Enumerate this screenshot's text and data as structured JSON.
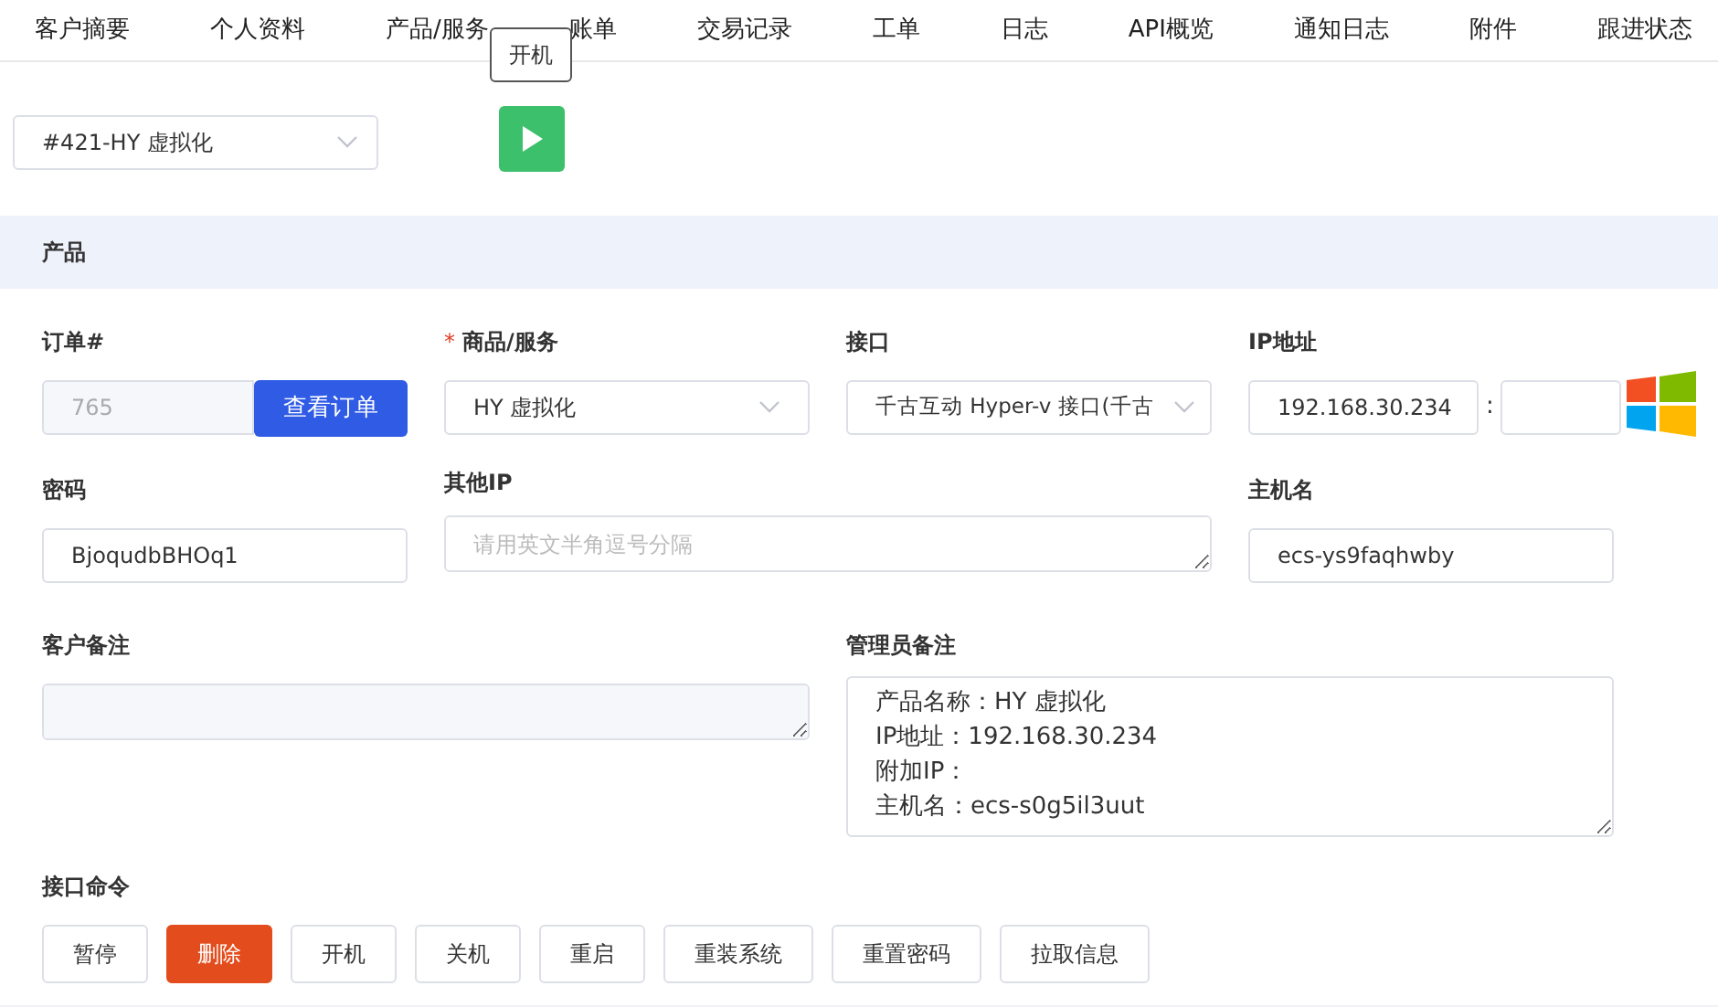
{
  "tabs": [
    {
      "label": "客户摘要",
      "selected": false
    },
    {
      "label": "个人资料",
      "selected": false
    },
    {
      "label": "产品/服务",
      "selected": false
    },
    {
      "label": "账单",
      "selected": false
    },
    {
      "label": "交易记录",
      "selected": false
    },
    {
      "label": "工单",
      "selected": false
    },
    {
      "label": "日志",
      "selected": false
    },
    {
      "label": "API概览",
      "selected": false
    },
    {
      "label": "通知日志",
      "selected": false
    },
    {
      "label": "附件",
      "selected": false
    },
    {
      "label": "跟进状态",
      "selected": false
    }
  ],
  "product_select": {
    "value": "#421-HY 虚拟化"
  },
  "power_button": {
    "tooltip": "开机"
  },
  "section": {
    "title": "产品"
  },
  "fields": {
    "order": {
      "label": "订单#",
      "value": "765",
      "disabled": true,
      "button": "查看订单"
    },
    "product": {
      "label": "商品/服务",
      "required_mark": "*",
      "value": "HY 虚拟化"
    },
    "interface": {
      "label": "接口",
      "value": "千古互动 Hyper-v 接口(千古"
    },
    "ip": {
      "label": "IP地址",
      "value": "192.168.30.234",
      "separator": ":"
    },
    "password": {
      "label": "密码",
      "value": "BjoqudbBHOq1"
    },
    "other_ip": {
      "label": "其他IP",
      "placeholder": "请用英文半角逗号分隔"
    },
    "hostname": {
      "label": "主机名",
      "value": "ecs-ys9faqhwby"
    },
    "customer_notes": {
      "label": "客户备注"
    },
    "admin_notes": {
      "label": "管理员备注",
      "lines": [
        "产品名称：HY 虚拟化",
        "IP地址：192.168.30.234",
        "附加IP：",
        "主机名：ecs-s0g5il3uut"
      ]
    }
  },
  "commands": {
    "label": "接口命令",
    "buttons": [
      {
        "label": "暂停",
        "kind": "default"
      },
      {
        "label": "删除",
        "kind": "danger"
      },
      {
        "label": "开机",
        "kind": "default"
      },
      {
        "label": "关机",
        "kind": "default"
      },
      {
        "label": "重启",
        "kind": "default"
      },
      {
        "label": "重装系统",
        "kind": "default"
      },
      {
        "label": "重置密码",
        "kind": "default"
      },
      {
        "label": "拉取信息",
        "kind": "default"
      }
    ]
  }
}
